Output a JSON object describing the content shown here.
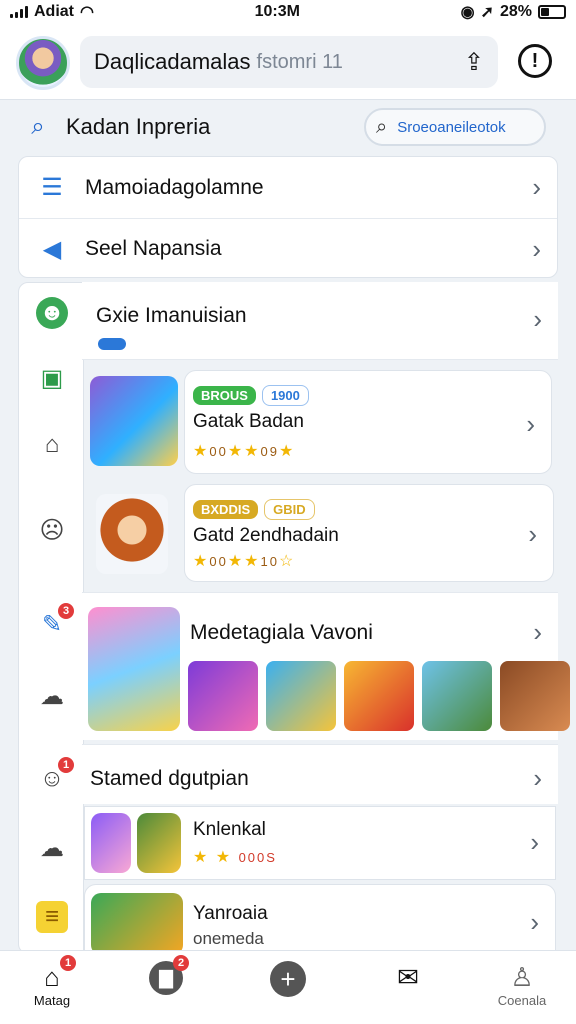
{
  "status": {
    "carrier": "Adiat",
    "time": "10:3M",
    "battery": "28%"
  },
  "header": {
    "title": "Daqlicadamalas",
    "hint": "fstomri 11"
  },
  "search": {
    "label": "Kadan Inpreria",
    "placeholder": "Sroeoaneileotok"
  },
  "menu": [
    {
      "icon": "menu-icon",
      "label": "Mamoiadagolamne"
    },
    {
      "icon": "megaphone-icon",
      "label": "Seel Napansia"
    }
  ],
  "section": {
    "title": "Gxie Imanuisian"
  },
  "games": [
    {
      "tag1": "BROUS",
      "tag2": "1900",
      "name": "Gatak Badan",
      "rating": "00",
      "rating2": "09"
    },
    {
      "tag1": "BXDDIS",
      "tag2": "GBID",
      "name": "Gatd 2endhadain",
      "rating": "00",
      "rating2": "10"
    }
  ],
  "featured": {
    "title": "Medetagiala Vavoni"
  },
  "stamped": {
    "title": "Stamed dgutpian"
  },
  "list": [
    {
      "name": "Knlenkal",
      "rating": "000S"
    },
    {
      "name": "Yanroaia",
      "sub": "onemeda"
    }
  ],
  "nav": [
    {
      "label": "Matag",
      "icon": "home-icon",
      "badge": "1"
    },
    {
      "label": "",
      "icon": "bag-icon",
      "badge": "2"
    },
    {
      "label": "",
      "icon": "plus-icon"
    },
    {
      "label": "",
      "icon": "inbox-icon"
    },
    {
      "label": "Coenala",
      "icon": "profile-icon"
    }
  ],
  "colors": {
    "accent": "#2b78d8",
    "badge": "#e23b3b",
    "star": "#f2b705"
  }
}
